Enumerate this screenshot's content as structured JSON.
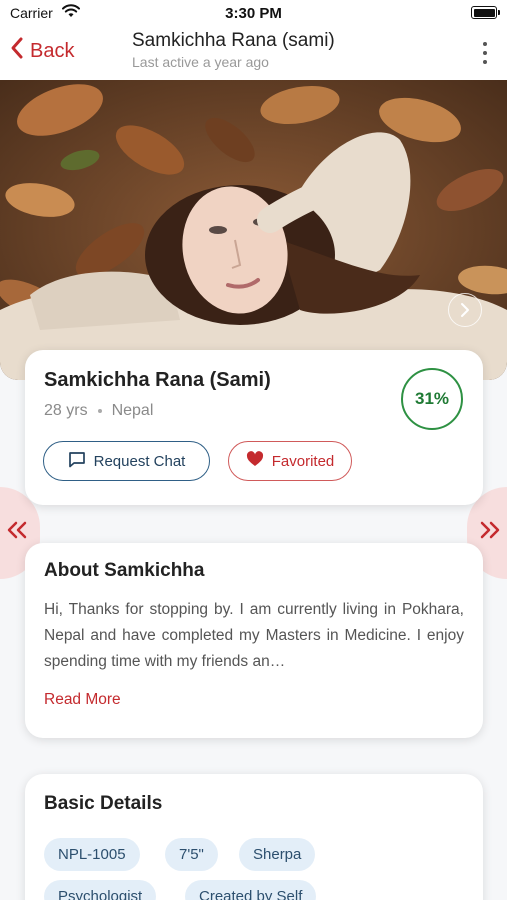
{
  "status_bar": {
    "carrier": "Carrier",
    "time": "3:30 PM"
  },
  "nav": {
    "back_label": "Back",
    "title": "Samkichha Rana (sami)",
    "subtitle": "Last active a year ago"
  },
  "profile": {
    "name": "Samkichha Rana (Sami)",
    "age": "28 yrs",
    "country": "Nepal",
    "match_percent": "31%",
    "request_chat_label": "Request Chat",
    "favorited_label": "Favorited"
  },
  "about": {
    "title": "About Samkichha",
    "text": "Hi, Thanks for stopping by. I am currently living in Pokhara, Nepal and have completed my Masters in Medicine. I enjoy spending time with my friends an…",
    "read_more_label": "Read More"
  },
  "basic_details": {
    "title": "Basic Details",
    "chips": [
      "NPL-1005",
      "7'5\"",
      "Sherpa",
      "Psychologist",
      "Created by Self"
    ]
  },
  "colors": {
    "accent_red": "#c42a2e",
    "match_green": "#2e9143",
    "chip_bg": "#e3eef8",
    "chat_border": "#2f5f86"
  },
  "icons": {
    "back": "chevron-left-icon",
    "menu": "more-vertical-icon",
    "photo_next": "chevron-right-circle-icon",
    "chat": "chat-bubble-icon",
    "favorite": "heart-icon",
    "prev_profile": "double-chevron-left-icon",
    "next_profile": "double-chevron-right-icon"
  }
}
